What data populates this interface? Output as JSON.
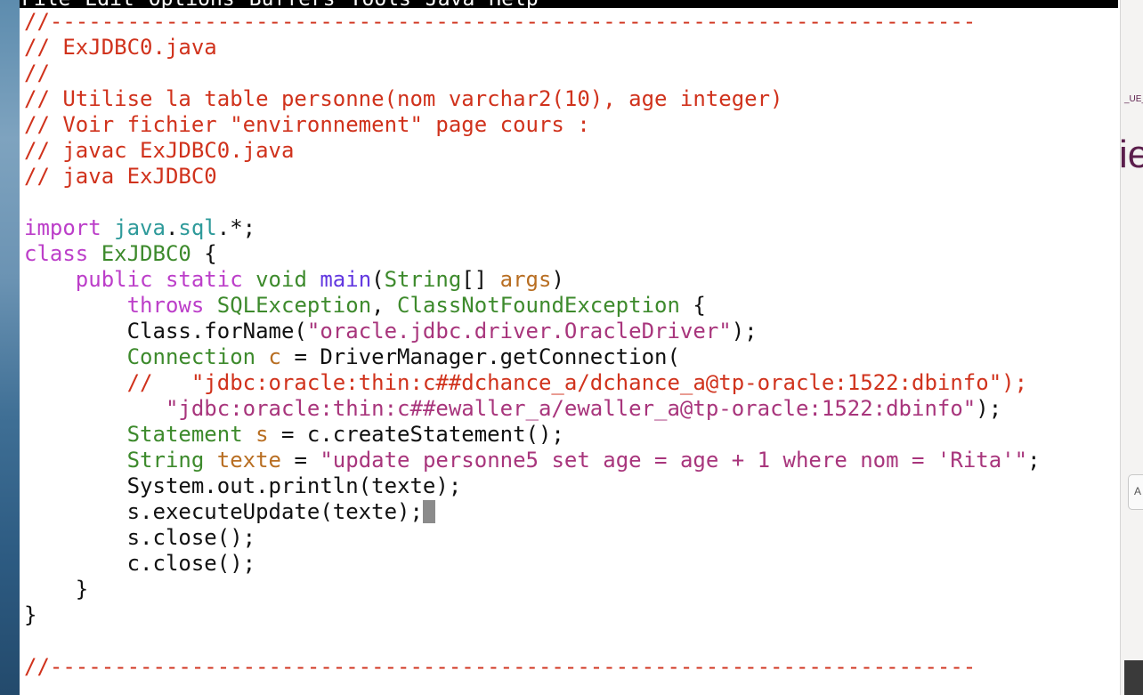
{
  "window": {
    "menu": [
      "File",
      "Edit",
      "Options",
      "Buffers",
      "Tools",
      "Java",
      "Help"
    ]
  },
  "background_window": {
    "tag_text": "_UE_",
    "big_text": "ie",
    "button_text": "A"
  },
  "colors": {
    "comment": "#d0321c",
    "keyword": "#bc3ec9",
    "package": "#2e9a9a",
    "type": "#3d8a2c",
    "function": "#6238e0",
    "variable": "#b86e22",
    "string": "#a8357c",
    "cursor": "#8b8b8b"
  },
  "code": {
    "l1": "//------------------------------------------------------------------------",
    "l2": "// ExJDBC0.java",
    "l3": "//",
    "l4": "// Utilise la table personne(nom varchar2(10), age integer)",
    "l5": "// Voir fichier \"environnement\" page cours :",
    "l6": "// javac ExJDBC0.java",
    "l7": "// java ExJDBC0",
    "l9_import": "import",
    "l9_pkg1": "java",
    "l9_dot": ".",
    "l9_pkg2": "sql",
    "l9_rest": ".*;",
    "l10_class": "class",
    "l10_name": "ExJDBC0",
    "l10_rest": " {",
    "l11_indent": "    ",
    "l11_mods": "public static",
    "l11_void": "void",
    "l11_main": "main",
    "l11_paren": "(",
    "l11_string": "String",
    "l11_arr": "[] ",
    "l11_args": "args",
    "l11_close": ")",
    "l12_indent": "        ",
    "l12_throws": "throws",
    "l12_ex1": "SQLException",
    "l12_comma": ", ",
    "l12_ex2": "ClassNotFoundException",
    "l12_brace": " {",
    "l13_pre": "        Class.forName(",
    "l13_str": "\"oracle.jdbc.driver.OracleDriver\"",
    "l13_post": ");",
    "l14_indent": "        ",
    "l14_type": "Connection",
    "l14_var": "c",
    "l14_post": " = DriverManager.getConnection(",
    "l15_indent": "        ",
    "l15_cmt": "//   \"jdbc:oracle:thin:c##dchance_a/dchance_a@tp-oracle:1522:dbinfo\");",
    "l16_indent": "           ",
    "l16_str": "\"jdbc:oracle:thin:c##ewaller_a/ewaller_a@tp-oracle:1522:dbinfo\"",
    "l16_post": ");",
    "l17_indent": "        ",
    "l17_type": "Statement",
    "l17_var": "s",
    "l17_post": " = c.createStatement();",
    "l18_indent": "        ",
    "l18_type": "String",
    "l18_var": "texte",
    "l18_eq": " = ",
    "l18_str": "\"update personne5 set age = age + 1 where nom = 'Rita'\"",
    "l18_post": ";",
    "l19": "        System.out.println(texte);",
    "l20": "        s.executeUpdate(texte);",
    "l21": "        s.close();",
    "l22": "        c.close();",
    "l23": "    }",
    "l24": "}",
    "l26": "//------------------------------------------------------------------------"
  }
}
